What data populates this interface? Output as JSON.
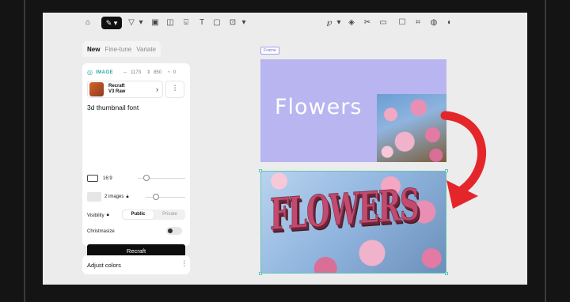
{
  "toolbar": {
    "left_icons": [
      "home-icon",
      "brush-icon",
      "select-icon",
      "image-icon",
      "eraser-icon",
      "bucket-icon",
      "text-icon",
      "comment-icon",
      "frame-icon"
    ],
    "right_icons": [
      "lasso-icon",
      "paint-icon",
      "scissors-icon",
      "mask-icon",
      "cup-icon",
      "crop-icon",
      "palette-icon",
      "style-icon"
    ]
  },
  "tabs": [
    {
      "label": "New",
      "active": true
    },
    {
      "label": "Fine-tune",
      "active": false
    },
    {
      "label": "Variate",
      "active": false
    }
  ],
  "panel": {
    "type_label": "IMAGE",
    "width": "1173",
    "height": "850",
    "credits": "0",
    "model_name_line1": "Recraft",
    "model_name_line2": "V3 Raw",
    "prompt": "3d thumbnail font",
    "aspect_label": "16:9",
    "images_label": "2 images",
    "visibility_label": "Visibility",
    "visibility_public": "Public",
    "visibility_private": "Private",
    "christmasize_label": "Christmasize",
    "generate_label": "Recraft"
  },
  "adjust": {
    "label": "Adjust colors"
  },
  "canvas": {
    "frame_tag": "Frame",
    "top_text": "Flowers",
    "bottom_text": "FLOWERS"
  },
  "colors": {
    "frame_bg": "#b9b5f0",
    "arrow": "#e4262b",
    "selection": "#62c4b8",
    "accent": "#29a7a0"
  }
}
